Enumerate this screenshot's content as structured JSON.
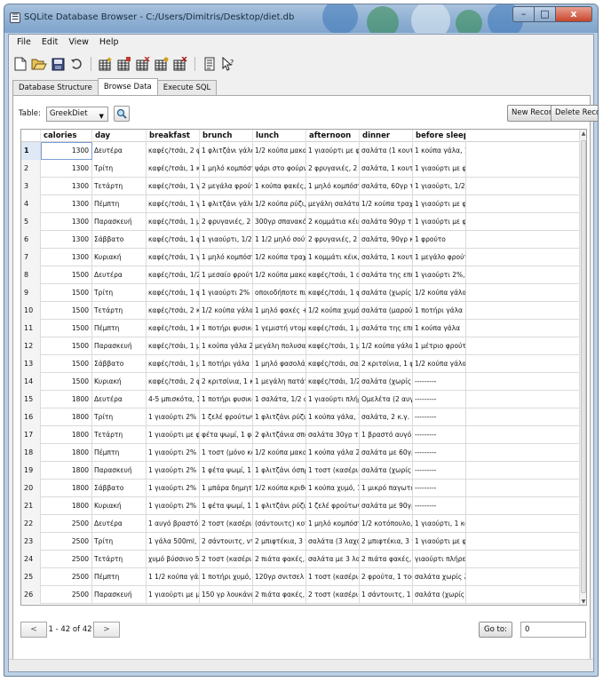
{
  "window": {
    "title": "SQLite Database Browser - C:/Users/Dimitris/Desktop/diet.db",
    "controls": {
      "minimize": "–",
      "maximize": "□",
      "close": "x"
    }
  },
  "menu": [
    "File",
    "Edit",
    "View",
    "Help"
  ],
  "toolbar": {
    "icons": [
      "new-file-icon",
      "open-folder-icon",
      "save-icon",
      "undo-icon",
      "create-table-icon",
      "modify-table-icon",
      "delete-table-icon",
      "create-index-icon",
      "delete-index-icon",
      "query-icon",
      "whats-this-icon"
    ]
  },
  "tabs": [
    "Database Structure",
    "Browse Data",
    "Execute SQL"
  ],
  "active_tab": "Browse Data",
  "browse": {
    "table_label": "Table:",
    "table_value": "GreekDiet",
    "new_record": "New Record",
    "delete_record": "Delete Record"
  },
  "columns": [
    "calories",
    "day",
    "breakfast",
    "brunch",
    "lunch",
    "afternoon",
    "dinner",
    "before sleep"
  ],
  "rows": [
    [
      "1",
      "1300",
      "Δευτέρα",
      "καφές/τσάι, 2 φρυγ",
      "1 φλιτζάνι γάλα 2%",
      "1/2 κούπα μακαρόνι",
      "1 γιαούρτι με φρουτ",
      "σαλάτα (1 κουταλιά",
      "1 κούπα γάλα, 1/2 κ"
    ],
    [
      "2",
      "1300",
      "Τρίτη",
      "καφές/τσάι, 1 κούπα",
      "1 μηλό κομπόστα, 2",
      "ψάρι στο φούρνο, 2",
      "2 φρυγανιές, 2 κουτ",
      "σαλάτα, 1 κουταλιά",
      "1 γιαούρτι με φρουτ"
    ],
    [
      "3",
      "1300",
      "Τετάρτη",
      "καφές/τσάι, 1 γιαούρ",
      "2 μεγάλα φρούτα",
      "1 κούπα φακές, 1 φ",
      "1 μηλό κομπόστα, 2",
      "σαλάτα, 60γρ τόνο σ",
      "1 γιαούρτι, 1/2 κούπ"
    ],
    [
      "4",
      "1300",
      "Πέμπτη",
      "καφές/τσάι, 1 γιαούρ",
      "1 φλιτζάνι γάλα 2%",
      "1/2 κούπα ρύζι, 90γ",
      "μεγάλη σαλάτα (χωρ",
      "1/2 κούπα τραχανά,",
      "1 γιαούρτι με φρουτ"
    ],
    [
      "5",
      "1300",
      "Παρασκευή",
      "καφές/τσάι, 1 μεγάλ",
      "2 φρυγανιές, 2 κουτ",
      "300γρ σπανακόρυζο",
      "2 κομμάτια κέικ, 1/2",
      "σαλάτα 90γρ τόνο σ",
      "1 γιαούρτι με φρουτ"
    ],
    [
      "6",
      "1300",
      "Σάββατο",
      "καφές/τσάι, 1 φρυγα",
      "1 γιαούρτι, 1/2 κουτ",
      "1 1/2 μηλό σούπα, 2",
      "2 φρυγανιές, 2 κουτ",
      "σαλάτα, 90γρ κοτόπ",
      "1 φρούτο"
    ],
    [
      "7",
      "1300",
      "Κυριακή",
      "καφές/τσάι, 1 γιαούρ",
      "1 μηλό κομπόστα",
      "1/2 κούπα τραχανά,",
      "1 κομμάτι κέικ, 1 κο",
      "σαλάτα, 1 κουταλιά",
      "1 μεγάλο φρούτο, 1"
    ],
    [
      "8",
      "1500",
      "Δευτέρα",
      "καφές/τσάι, 1/2 κούπ",
      "1 μεσαίο φρούτο",
      "1/2 κούπα μακαρόνι",
      "καφές/τσάι, 1 αυγό",
      "σαλάτα της επιλογής",
      "1 γιαούρτι 2%, 1 κο"
    ],
    [
      "9",
      "1500",
      "Τρίτη",
      "καφές/τσάι, 1 φέτα",
      "1 γιαούρτι 2% με φρ",
      "οποιοδήποτε πιατ",
      "καφές/τσάι, 1 φρούτ",
      "σαλάτα (χωρίς λάδι)",
      "1/2 κούπα γάλα, 1/2"
    ],
    [
      "10",
      "1500",
      "Τετάρτη",
      "καφές/τσάι, 2 κριτσί",
      "1/2 κούπα γάλα, 1/2",
      "1 μηλό φακές + σαλ",
      "1/2 κούπα χυμό, 1 φ",
      "σαλάτα (μαρούλι, ντ",
      "1 ποτήρι γάλα 2%, 2"
    ],
    [
      "11",
      "1500",
      "Πέμπτη",
      "καφές/τσάι, 1 κούπα",
      "1 ποτήρι φυσικό χυμ",
      "1 γεμιστή ντομάτα ή",
      "καφές/τσάι, 1 μηλό",
      "σαλάτα της επιλογής",
      "1 κούπα γάλα"
    ],
    [
      "12",
      "1500",
      "Παρασκευή",
      "καφές/τσάι, 1 μεγάλ",
      "1 κούπα γάλα 2%, 2",
      "μεγάλη πολυσαλάτα",
      "καφές/τσάι, 1 μηλό",
      "1/2 κούπα γάλα, 1/2",
      "1 μέτριο φρούτο"
    ],
    [
      "13",
      "1500",
      "Σάββατο",
      "καφές/τσάι, 1 μεγάλ",
      "1 ποτήρι γάλα 2%",
      "1 μηλό φασολάκια,",
      "καφές/τσάι, σαλάτα",
      "2 κριτσίνια, 1 φέτα",
      "1/2 κούπα γάλα, 1/2"
    ],
    [
      "14",
      "1500",
      "Κυριακή",
      "καφές/τσάι, 2 φρυγα",
      "2 κριτσίνια, 1 κούπα",
      "1 μεγάλη πατάτα στ",
      "καφές/τσάι, 1/2 κού",
      "σαλάτα (χωρίς λάδι)",
      "---------"
    ],
    [
      "15",
      "1800",
      "Δευτέρα",
      "4-5 μπισκότα, 1 κού",
      "1 ποτήρι φυσικό χυμ",
      "1 σαλάτα, 1/2 φλιτζ",
      "1 γιαούρτι πλήρες, 1",
      "Ομελέτα (2 αυγά), 2",
      "---------"
    ],
    [
      "16",
      "1800",
      "Τρίτη",
      "1 γιαούρτι 2% με φρ",
      "1 ζελέ φρούτων, 2 κ",
      "1 φλιτζάνι ρύζι (3",
      "1 κούπα γάλα, 1/2 κ",
      "σαλάτα, 2 κ.γ. ελαι",
      "---------"
    ],
    [
      "17",
      "1800",
      "Τετάρτη",
      "1 γιαούρτι με φρούτ",
      "φέτα ψωμί, 1 φέτα",
      "2 φλιτζάνια σπανακ",
      "σαλάτα 30γρ τόνο σ",
      "1 βραστό αυγό, 2 κρ",
      "---------"
    ],
    [
      "18",
      "1800",
      "Πέμπτη",
      "1 γιαούρτι 2% με φρ",
      "1 τοστ (μόνο κασέρι",
      "1/2 κούπα μακαρόνι",
      "1 κούπα γάλα 2% μ",
      "σαλάτα με 60γρ κοτ",
      "---------"
    ],
    [
      "19",
      "1800",
      "Παρασκευή",
      "1 γιαούρτι 2% με 1/",
      "1 φέτα ψωμί, 1 κ.γ.",
      "1 φλιτζάνι όσπρια, 30γ",
      "1 τοστ (κασέρι-γαλο",
      "σαλάτα (χωρίς λάδι)",
      "---------"
    ],
    [
      "20",
      "1800",
      "Σάββατο",
      "1 γιαούρτι 2% με 2",
      "1 μπάρα δημητριακώ",
      "1/2 κούπα κριθαράκ",
      "1 κούπα χυμό, 1 τοσ",
      "1 μικρό παγωτό",
      "---------"
    ],
    [
      "21",
      "1800",
      "Κυριακή",
      "1 γιαούρτι 2% με φρ",
      "1 φέτα ψωμί, 1 κ.γ.",
      "1 φλιτζάνι ρύζι, 90γ",
      "1 ζελέ φρούτων, 1 φ",
      "σαλάτα με 90γρ τόν",
      "---------"
    ],
    [
      "22",
      "2500",
      "Δευτέρα",
      "1 αυγό βραστό, 1 1/2",
      "2 τοστ (κασέρι-γαλο",
      "(σάντουιτς) κοτόπου",
      "1 μηλό κομπόστα, 2",
      "1/2 κοτόπουλο, 1 κο",
      "1 γιαούρτι, 1 κουταλ"
    ],
    [
      "23",
      "2500",
      "Τρίτη",
      "1 γάλα 500ml, 1 κρο",
      "2 σάντουιτς, ντομάτ",
      "2 μπιφτέκια, 3 πατά",
      "σαλάτα (3 λαχανικά",
      "2 μπιφτέκια, 3 πατά",
      "1 γιαούρτι με φρουτ"
    ],
    [
      "24",
      "2500",
      "Τετάρτη",
      "χυμό βύσσινο 500ml",
      "2 τοστ (κασέρι-γαλο",
      "2 πιάτα φακές, 2 φρ",
      "σαλάτα με 3 λαχανι",
      "2 πιάτα φακές, 90γρ",
      "γιαούρτι πλήρες με μ"
    ],
    [
      "25",
      "2500",
      "Πέμπτη",
      "1 1/2 κούπα γάλα π",
      "1 ποτήρι χυμό, 1 βρ",
      "120γρ σνιτσελ (βραστ",
      "1 τοστ (κασέρι-γαλο",
      "2 φρούτα, 1 τοστ (κ",
      "σαλάτα χωρίς λάδι μ"
    ],
    [
      "26",
      "2500",
      "Παρασκευή",
      "1 γιαούρτι με μέλι, 1",
      "150 γρ λουκάνικα (τ",
      "2 πιάτα φακές, 2 φέ",
      "2 τοστ (κασέρι-γαλο",
      "1 σάντουιτς, 1 μηλό",
      "σαλάτα (χωρίς λάδι)"
    ]
  ],
  "navigation": {
    "prev": "<",
    "next": ">",
    "record_info": "1 - 42 of 42",
    "goto_label": "Go to:",
    "goto_value": "0"
  }
}
